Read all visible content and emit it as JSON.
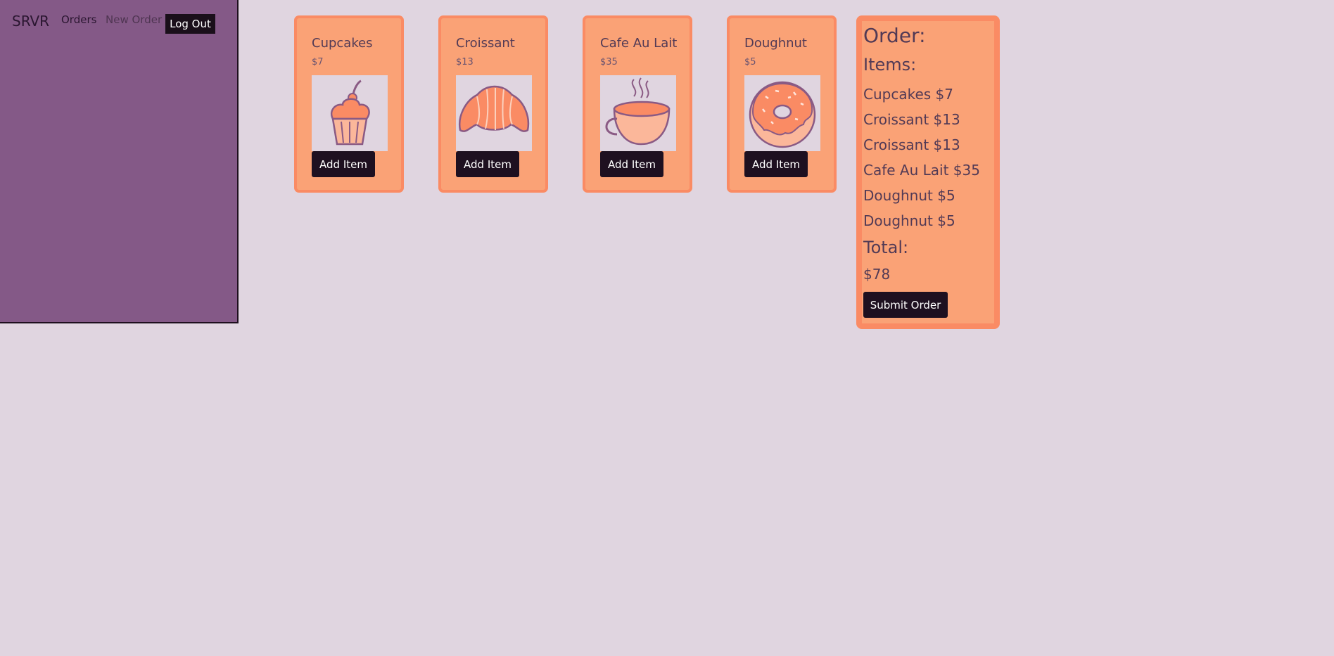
{
  "nav": {
    "brand": "SRVR",
    "orders_label": "Orders",
    "new_order_label": "New Order",
    "logout_label": "Log Out"
  },
  "menu": [
    {
      "name": "Cupcakes",
      "price": "$7",
      "button_label": "Add Item",
      "icon": "cupcake-icon"
    },
    {
      "name": "Croissant",
      "price": "$13",
      "button_label": "Add Item",
      "icon": "croissant-icon"
    },
    {
      "name": "Cafe Au Lait",
      "price": "$35",
      "button_label": "Add Item",
      "icon": "coffee-cup-icon"
    },
    {
      "name": "Doughnut",
      "price": "$5",
      "button_label": "Add Item",
      "icon": "doughnut-icon"
    }
  ],
  "order": {
    "heading": "Order:",
    "items_heading": "Items:",
    "items": [
      "Cupcakes $7",
      "Croissant $13",
      "Croissant $13",
      "Cafe Au Lait $35",
      "Doughnut $5",
      "Doughnut $5"
    ],
    "total_heading": "Total:",
    "total_value": "$78",
    "submit_label": "Submit Order"
  },
  "colors": {
    "background": "#e0d5e0",
    "sidebar": "#845987",
    "card": "#faa276",
    "card_border": "#fa8b64",
    "button": "#1e1020",
    "text": "#523a55"
  }
}
